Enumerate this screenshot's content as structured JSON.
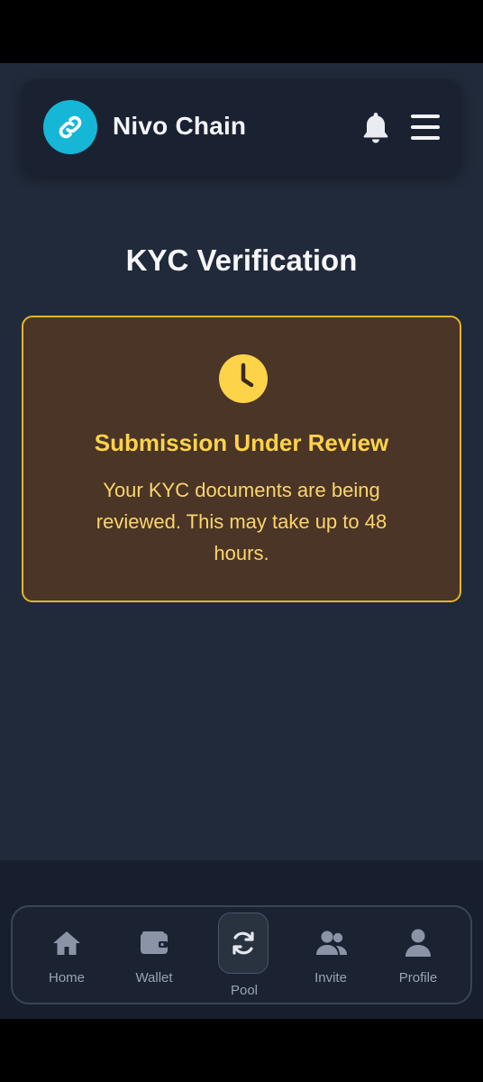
{
  "app": {
    "name": "Nivo Chain"
  },
  "page": {
    "title": "KYC Verification"
  },
  "status_card": {
    "title": "Submission Under Review",
    "message": "Your KYC documents are being reviewed. This may take up to 48 hours.",
    "icon": "clock-icon",
    "border_color": "#e5b42b",
    "text_color": "#fdd34a"
  },
  "bottom_nav": {
    "items": [
      {
        "label": "Home",
        "icon": "home-icon"
      },
      {
        "label": "Wallet",
        "icon": "wallet-icon"
      },
      {
        "label": "Pool",
        "icon": "refresh-icon"
      },
      {
        "label": "Invite",
        "icon": "users-icon"
      },
      {
        "label": "Profile",
        "icon": "user-icon"
      }
    ]
  },
  "colors": {
    "background": "#212a3a",
    "accent": "#16b6d6",
    "warning": "#fdd34a"
  }
}
